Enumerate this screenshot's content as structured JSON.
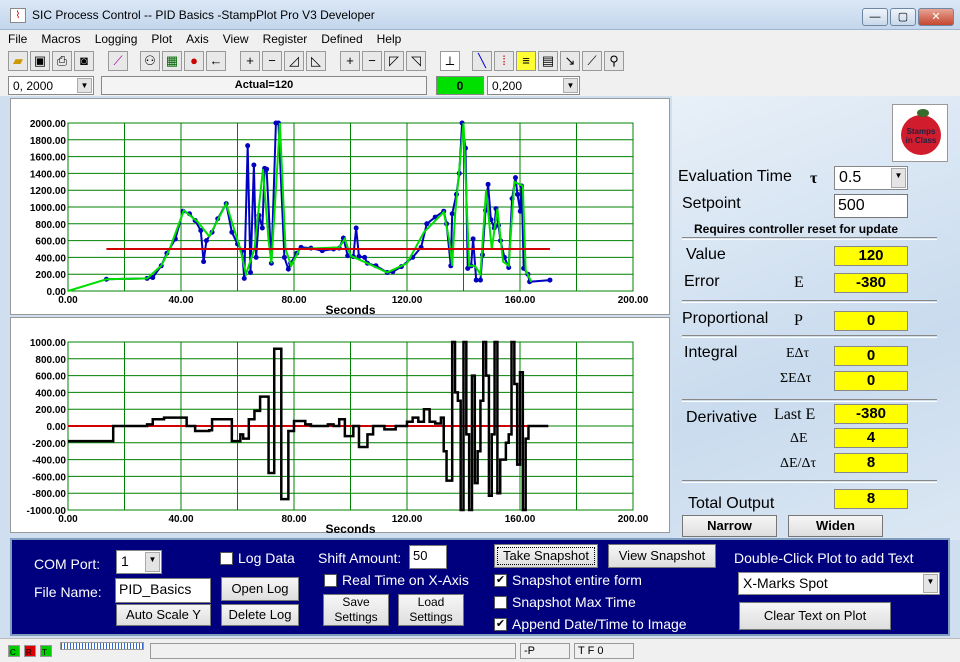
{
  "window": {
    "title": "SIC Process Control -- PID Basics -StampPlot Pro V3 Developer",
    "minimize": "—",
    "maximize": "▢",
    "close": "✕"
  },
  "menu": [
    "File",
    "Macros",
    "Logging",
    "Plot",
    "Axis",
    "View",
    "Register",
    "Defined",
    "Help"
  ],
  "toolbar": {
    "icons": [
      "open-folder",
      "save-disk",
      "printer",
      "camera",
      "magic-wand",
      "plot-connect",
      "monitor",
      "stop",
      "back-arrow",
      "plus",
      "minus",
      "shift-up",
      "shift-down",
      "plus",
      "minus",
      "shift-left",
      "shift-right",
      "plot-axis",
      "pen",
      "data-points",
      "note",
      "calculator",
      "probe",
      "scale",
      "wrench"
    ]
  },
  "row2": {
    "y_range": "0, 2000",
    "message": "Actual=120",
    "status_value": "0",
    "x_range": "0,200",
    "status_color": "#00e000"
  },
  "chart_data": [
    {
      "type": "line",
      "xlabel": "Seconds",
      "ylabel": "",
      "xlim": [
        0,
        200
      ],
      "ylim": [
        0,
        2000
      ],
      "xticks": [
        "0.00",
        "40.00",
        "80.00",
        "120.00",
        "160.00",
        "200.00"
      ],
      "yticks": [
        "0.00",
        "200.00",
        "400.00",
        "600.00",
        "800.00",
        "1000.00",
        "1200.00",
        "1400.00",
        "1600.00",
        "1800.00",
        "2000.00"
      ],
      "grid": true,
      "series": [
        {
          "color": "#0000c0",
          "markers": true,
          "points": [
            [
              13.6,
              140
            ],
            [
              28,
              150
            ],
            [
              30,
              160
            ],
            [
              33,
              300
            ],
            [
              35,
              450
            ],
            [
              38,
              620
            ],
            [
              40.7,
              950
            ],
            [
              43,
              920
            ],
            [
              45,
              840
            ],
            [
              47,
              720
            ],
            [
              48,
              350
            ],
            [
              49,
              600
            ],
            [
              51,
              700
            ],
            [
              53,
              860
            ],
            [
              56,
              1040
            ],
            [
              58,
              700
            ],
            [
              60,
              560
            ],
            [
              61.6,
              480
            ],
            [
              62.4,
              150
            ],
            [
              63.6,
              1730
            ],
            [
              64.6,
              220
            ],
            [
              65.8,
              1500
            ],
            [
              66.6,
              400
            ],
            [
              67.6,
              900
            ],
            [
              68.8,
              750
            ],
            [
              69.6,
              1460
            ],
            [
              70.3,
              1450
            ],
            [
              72,
              330
            ],
            [
              73.6,
              2000
            ],
            [
              74.5,
              2000
            ],
            [
              76.6,
              400
            ],
            [
              78,
              260
            ],
            [
              78.8,
              330
            ],
            [
              81,
              450
            ],
            [
              82.5,
              520
            ],
            [
              86,
              510
            ],
            [
              90,
              480
            ],
            [
              94,
              500
            ],
            [
              96,
              510
            ],
            [
              97.5,
              630
            ],
            [
              99,
              420
            ],
            [
              101,
              410
            ],
            [
              102,
              750
            ],
            [
              103,
              410
            ],
            [
              105,
              400
            ],
            [
              106,
              330
            ],
            [
              109,
              300
            ],
            [
              113,
              220
            ],
            [
              115,
              230
            ],
            [
              118,
              290
            ],
            [
              122,
              400
            ],
            [
              125,
              520
            ],
            [
              127,
              800
            ],
            [
              130,
              880
            ],
            [
              133,
              950
            ],
            [
              134,
              800
            ],
            [
              135.5,
              300
            ],
            [
              136,
              920
            ],
            [
              137.5,
              1150
            ],
            [
              138.5,
              1400
            ],
            [
              139.5,
              2000
            ],
            [
              140.7,
              1700
            ],
            [
              141.5,
              270
            ],
            [
              142.7,
              300
            ],
            [
              143.4,
              620
            ],
            [
              144.5,
              130
            ],
            [
              146,
              130
            ],
            [
              146.7,
              430
            ],
            [
              147.8,
              960
            ],
            [
              148.7,
              1270
            ],
            [
              149.7,
              850
            ],
            [
              150.9,
              750
            ],
            [
              151.5,
              980
            ],
            [
              152.4,
              780
            ],
            [
              153.1,
              600
            ],
            [
              154.5,
              400
            ],
            [
              156,
              280
            ],
            [
              157.2,
              1100
            ],
            [
              158.4,
              1350
            ],
            [
              159.1,
              1150
            ],
            [
              160.1,
              950
            ],
            [
              160.6,
              1250
            ],
            [
              161.3,
              270
            ],
            [
              162.8,
              200
            ],
            [
              163.4,
              110
            ],
            [
              170.6,
              130
            ]
          ]
        },
        {
          "color": "#00e000",
          "markers": false,
          "points": [
            [
              0,
              0
            ],
            [
              13.6,
              140
            ],
            [
              28,
              150
            ],
            [
              33,
              300
            ],
            [
              36,
              500
            ],
            [
              41,
              960
            ],
            [
              46,
              820
            ],
            [
              50,
              650
            ],
            [
              56,
              1040
            ],
            [
              61,
              500
            ],
            [
              63,
              200
            ],
            [
              66,
              500
            ],
            [
              69,
              1450
            ],
            [
              71,
              600
            ],
            [
              72,
              330
            ],
            [
              75,
              2000
            ],
            [
              77,
              500
            ],
            [
              79,
              300
            ],
            [
              82,
              500
            ],
            [
              96,
              520
            ],
            [
              98,
              620
            ],
            [
              100,
              420
            ],
            [
              106,
              330
            ],
            [
              113,
              220
            ],
            [
              120,
              330
            ],
            [
              126,
              700
            ],
            [
              133,
              940
            ],
            [
              135,
              600
            ],
            [
              136,
              300
            ],
            [
              137,
              900
            ],
            [
              140,
              2000
            ],
            [
              142,
              300
            ],
            [
              144,
              300
            ],
            [
              146,
              200
            ],
            [
              148,
              1200
            ],
            [
              150,
              500
            ],
            [
              152,
              980
            ],
            [
              154,
              350
            ],
            [
              156,
              300
            ],
            [
              158,
              1300
            ],
            [
              161,
              1250
            ],
            [
              162,
              250
            ],
            [
              164,
              110
            ]
          ]
        },
        {
          "color": "#d00000",
          "markers": false,
          "points": [
            [
              13.6,
              500
            ],
            [
              170.6,
              500
            ]
          ]
        }
      ]
    },
    {
      "type": "line",
      "xlabel": "Seconds",
      "ylabel": "",
      "xlim": [
        0,
        200
      ],
      "ylim": [
        -1000,
        1000
      ],
      "xticks": [
        "0.00",
        "40.00",
        "80.00",
        "120.00",
        "160.00",
        "200.00"
      ],
      "yticks": [
        "-1000.00",
        "-800.00",
        "-600.00",
        "-400.00",
        "-200.00",
        "0.00",
        "200.00",
        "400.00",
        "600.00",
        "800.00",
        "1000.00"
      ],
      "grid": true,
      "series": [
        {
          "color": "#d00000",
          "step": false,
          "points": [
            [
              0,
              0
            ],
            [
              170,
              0
            ]
          ]
        },
        {
          "color": "#000000",
          "step": true,
          "points": [
            [
              0,
              -180
            ],
            [
              16,
              0
            ],
            [
              28,
              20
            ],
            [
              30,
              80
            ],
            [
              34,
              100
            ],
            [
              40,
              100
            ],
            [
              42,
              0
            ],
            [
              45,
              -60
            ],
            [
              50,
              -50
            ],
            [
              51,
              80
            ],
            [
              57,
              80
            ],
            [
              58,
              -180
            ],
            [
              61,
              -100
            ],
            [
              62,
              -150
            ],
            [
              64,
              80
            ],
            [
              66,
              180
            ],
            [
              68,
              350
            ],
            [
              70,
              350
            ],
            [
              71,
              -560
            ],
            [
              73,
              920
            ],
            [
              75.5,
              -870
            ],
            [
              78,
              -60
            ],
            [
              80,
              60
            ],
            [
              84,
              20
            ],
            [
              86,
              0
            ],
            [
              92,
              20
            ],
            [
              94,
              0
            ],
            [
              96,
              80
            ],
            [
              98,
              -120
            ],
            [
              101,
              0
            ],
            [
              103,
              -250
            ],
            [
              106,
              -100
            ],
            [
              108,
              0
            ],
            [
              112,
              -40
            ],
            [
              116,
              0
            ],
            [
              120,
              50
            ],
            [
              122,
              100
            ],
            [
              124,
              50
            ],
            [
              126,
              200
            ],
            [
              128,
              50
            ],
            [
              130,
              30
            ],
            [
              132,
              100
            ],
            [
              133,
              -300
            ],
            [
              134,
              -650
            ],
            [
              136,
              1000
            ],
            [
              137,
              400
            ],
            [
              138,
              300
            ],
            [
              139,
              -1000
            ],
            [
              140,
              1000
            ],
            [
              141,
              -100
            ],
            [
              142,
              -1000
            ],
            [
              143,
              600
            ],
            [
              144,
              -680
            ],
            [
              145,
              -300
            ],
            [
              146,
              300
            ],
            [
              147,
              1000
            ],
            [
              148,
              600
            ],
            [
              149,
              -830
            ],
            [
              150,
              -100
            ],
            [
              151,
              1000
            ],
            [
              152,
              -800
            ],
            [
              153,
              -400
            ],
            [
              155,
              -200
            ],
            [
              156,
              -100
            ],
            [
              157,
              1000
            ],
            [
              158,
              500
            ],
            [
              159,
              -460
            ],
            [
              160,
              640
            ],
            [
              161,
              -1000
            ],
            [
              162,
              -150
            ],
            [
              163,
              0
            ],
            [
              170,
              0
            ]
          ]
        }
      ]
    }
  ],
  "right": {
    "logo_text": "Stamps in Class",
    "eval_time_label": "Evaluation Time",
    "tau": "τ",
    "eval_time_value": "0.5",
    "setpoint_label": "Setpoint",
    "setpoint_value": "500",
    "reset_note": "Requires controller reset for update",
    "value_label": "Value",
    "value": "120",
    "error_label": "Error",
    "error_sym": "E",
    "error": "-380",
    "prop_label": "Proportional",
    "prop_sym": "P",
    "prop": "0",
    "integral_label": "Integral",
    "int_sym1": "EΔτ",
    "int1": "0",
    "int_sym2": "ΣEΔτ",
    "int2": "0",
    "deriv_label": "Derivative",
    "der_sym1": "Last E",
    "der1": "-380",
    "der_sym2": "ΔE",
    "der2": "4",
    "der_sym3": "ΔE/Δτ",
    "der3": "8",
    "total_label": "Total Output",
    "total": "8",
    "narrow": "Narrow",
    "widen": "Widen"
  },
  "bottom": {
    "com_label": "COM Port:",
    "com_value": "1",
    "file_label": "File Name:",
    "file_value": "PID_Basics",
    "log_data": "Log Data",
    "open_log": "Open Log",
    "delete_log": "Delete Log",
    "auto_scale": "Auto Scale Y",
    "shift_label": "Shift Amount:",
    "shift_value": "50",
    "realtime": "Real Time on X-Axis",
    "save_settings": "Save Settings",
    "load_settings": "Load Settings",
    "take_snapshot": "Take Snapshot",
    "view_snapshot": "View Snapshot",
    "snap_entire": "Snapshot entire form",
    "snap_entire_checked": true,
    "snap_max": "Snapshot Max Time",
    "snap_max_checked": false,
    "append_date": "Append Date/Time to Image",
    "append_date_checked": true,
    "dbl_click": "Double-Click Plot to add Text",
    "text_choice": "X-Marks Spot",
    "clear_text": "Clear Text on Plot"
  },
  "status": {
    "c": "C",
    "r": "R",
    "t": "T",
    "p": "-P",
    "tf": "T F 0"
  }
}
